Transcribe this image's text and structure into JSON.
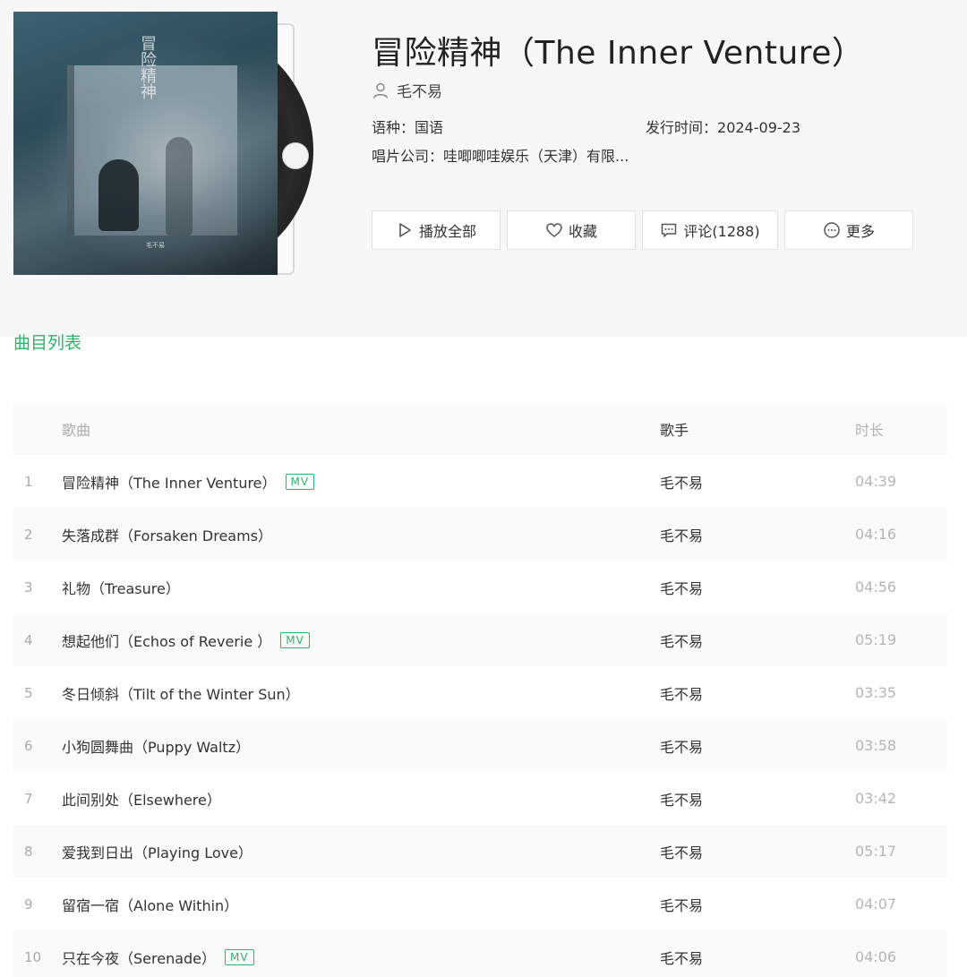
{
  "album": {
    "title": "冒险精神（The Inner Venture）",
    "artist": "毛不易",
    "language_label": "语种：",
    "language": "国语",
    "release_label": "发行时间：",
    "release_date": "2024-09-23",
    "label_label": "唱片公司：",
    "label": "哇唧唧哇娱乐（天津）有限...",
    "cover_text": "冒险精神",
    "cover_sign": "毛不易"
  },
  "actions": {
    "play_all": "播放全部",
    "favorite": "收藏",
    "comments": "评论(1288)",
    "more": "更多"
  },
  "section_title": "曲目列表",
  "table": {
    "headers": {
      "song": "歌曲",
      "artist": "歌手",
      "duration": "时长"
    },
    "rows": [
      {
        "idx": "1",
        "title": "冒险精神（The Inner Venture）",
        "mv": "MV",
        "artist": "毛不易",
        "duration": "04:39"
      },
      {
        "idx": "2",
        "title": "失落成群（Forsaken Dreams）",
        "mv": "",
        "artist": "毛不易",
        "duration": "04:16"
      },
      {
        "idx": "3",
        "title": "礼物（Treasure）",
        "mv": "",
        "artist": "毛不易",
        "duration": "04:56"
      },
      {
        "idx": "4",
        "title": "想起他们（Echos of Reverie ）",
        "mv": "MV",
        "artist": "毛不易",
        "duration": "05:19"
      },
      {
        "idx": "5",
        "title": "冬日倾斜（Tilt of the Winter Sun）",
        "mv": "",
        "artist": "毛不易",
        "duration": "03:35"
      },
      {
        "idx": "6",
        "title": "小狗圆舞曲（Puppy Waltz）",
        "mv": "",
        "artist": "毛不易",
        "duration": "03:58"
      },
      {
        "idx": "7",
        "title": "此间别处（Elsewhere）",
        "mv": "",
        "artist": "毛不易",
        "duration": "03:42"
      },
      {
        "idx": "8",
        "title": "爱我到日出（Playing Love）",
        "mv": "",
        "artist": "毛不易",
        "duration": "05:17"
      },
      {
        "idx": "9",
        "title": "留宿一宿（Alone Within）",
        "mv": "",
        "artist": "毛不易",
        "duration": "04:07"
      },
      {
        "idx": "10",
        "title": "只在今夜（Serenade）",
        "mv": "MV",
        "artist": "毛不易",
        "duration": "04:06"
      }
    ]
  },
  "colors": {
    "accent": "#2fb36b"
  }
}
